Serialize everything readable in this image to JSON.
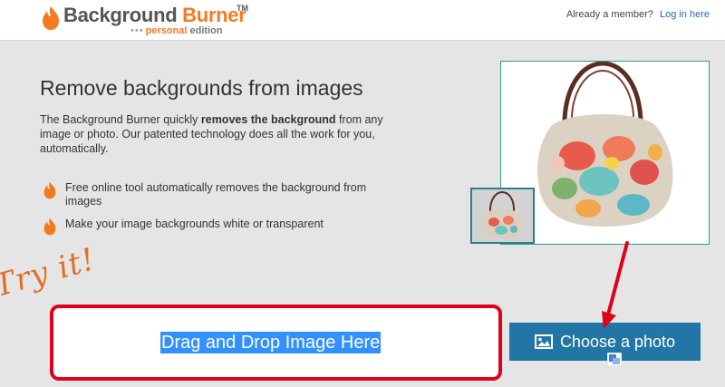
{
  "header": {
    "brand": {
      "word1": "Background",
      "word2": "Burner",
      "trademark": "TM",
      "dots": "•••",
      "edition_prefix": "personal",
      "edition_suffix": "edition",
      "icon": "flame-icon"
    },
    "member_prompt": "Already a member?",
    "login_link": "Log in here"
  },
  "main": {
    "headline": "Remove backgrounds from images",
    "intro_before": "The Background Burner quickly ",
    "intro_bold": "removes the background",
    "intro_after": " from any image or photo. Our patented technology does all the work for you, automatically.",
    "features": [
      {
        "text": "Free online tool automatically removes the background from images",
        "icon": "flame-icon"
      },
      {
        "text": "Make your image backgrounds white or transparent",
        "icon": "flame-icon"
      }
    ]
  },
  "try_it": "Try it!",
  "upload": {
    "drop_label": "Drag and Drop Image Here",
    "choose_button": "Choose a photo",
    "button_icon": "image-icon"
  },
  "colors": {
    "accent_orange": "#f47a20",
    "button_blue": "#2276a6",
    "drop_border_red": "#e0001b",
    "selection_blue": "#3390ff",
    "link_blue": "#2a6bb0"
  }
}
